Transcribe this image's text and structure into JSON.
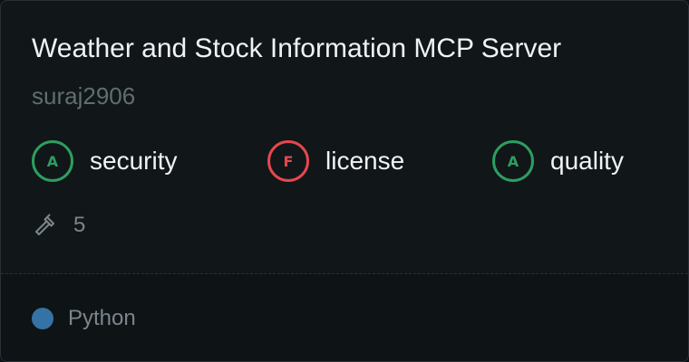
{
  "server": {
    "title": "Weather and Stock Information MCP Server",
    "owner": "suraj2906"
  },
  "scores": [
    {
      "grade": "A",
      "label": "security",
      "status": "good"
    },
    {
      "grade": "F",
      "label": "license",
      "status": "bad"
    },
    {
      "grade": "A",
      "label": "quality",
      "status": "good"
    }
  ],
  "tools": {
    "icon": "hammer-icon",
    "count": "5"
  },
  "language": {
    "name": "Python",
    "color": "#3572A5"
  },
  "colors": {
    "good": "#2d9e5f",
    "bad": "#e5484d",
    "background": "#111619"
  }
}
